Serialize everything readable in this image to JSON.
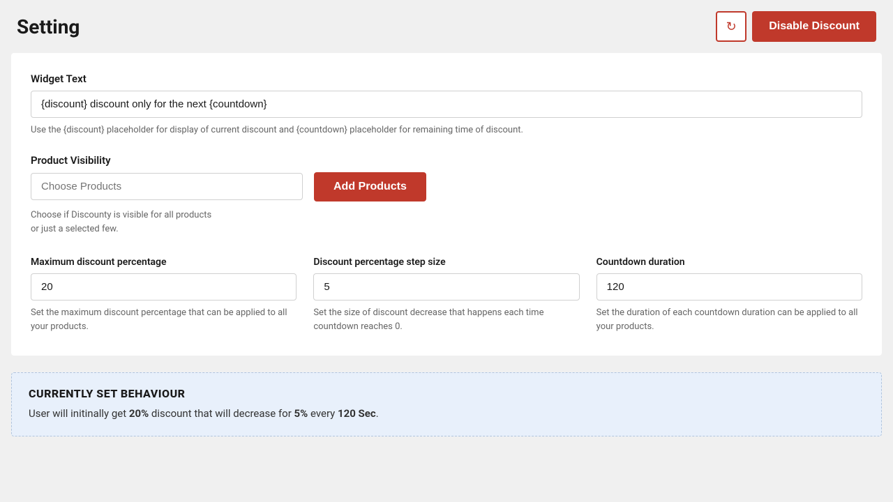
{
  "header": {
    "title": "Setting",
    "refresh_icon": "↻",
    "disable_discount_label": "Disable Discount"
  },
  "main": {
    "widget_text_section": {
      "label": "Widget Text",
      "input_value": "{discount} discount only for the next {countdown}",
      "hint": "Use the {discount} placeholder for display of current discount and {countdown} placeholder for remaining time of discount."
    },
    "product_visibility_section": {
      "label": "Product Visibility",
      "choose_placeholder": "Choose Products",
      "add_button_label": "Add Products",
      "hint_line1": "Choose if Discounty is visible for all products",
      "hint_line2": "or just a selected few."
    },
    "maximum_discount": {
      "label": "Maximum discount percentage",
      "value": "20",
      "hint": "Set the maximum discount percentage that can be applied to all your products."
    },
    "discount_step": {
      "label": "Discount percentage step size",
      "value": "5",
      "hint": "Set the size of discount decrease that happens each time countdown reaches 0."
    },
    "countdown_duration": {
      "label": "Countdown duration",
      "value": "120",
      "hint": "Set the duration of each countdown duration can be applied to all your products."
    }
  },
  "behaviour": {
    "title": "CURRENTLY SET BEHAVIOUR",
    "desc_prefix": "User will initinally get ",
    "discount_value": "20%",
    "desc_middle": " discount that will decrease for ",
    "step_value": "5%",
    "desc_middle2": " every ",
    "duration_value": "120 Sec",
    "desc_suffix": "."
  }
}
